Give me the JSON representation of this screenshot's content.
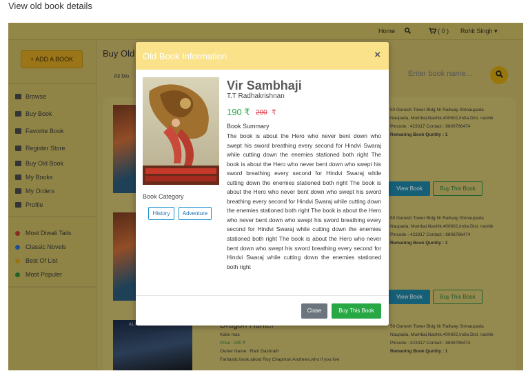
{
  "caption": "View old book details",
  "topbar": {
    "home": "Home",
    "cart_count": "( 0 )",
    "user": "Rohit Singh ▾"
  },
  "sidebar": {
    "add_button": "+ ADD A BOOK",
    "nav": [
      "Browse",
      "Buy Book",
      "Favorite Book",
      "Register Store",
      "Buy Old Book",
      "My Books",
      "My Orders",
      "Profile"
    ],
    "lists": [
      {
        "label": "Most Diwali Tails",
        "color": "#c0392b"
      },
      {
        "label": "Classic Novels",
        "color": "#2c6fd1"
      },
      {
        "label": "Best Of List",
        "color": "#d4a017"
      },
      {
        "label": "Most Populer",
        "color": "#2e8b3a"
      }
    ]
  },
  "main": {
    "title": "Buy Old",
    "tabs": "All  Mo",
    "search_placeholder": "Enter book name...",
    "cards": [
      {
        "address": "50 Ganesh Tower Bldg Nr Railway Stnnaupada",
        "address2": "Naupada, Mumbai,Nashik,400602,India Dist. nashik",
        "pincode": "Pincode : 423317 Contact : 8806786474",
        "quantity": "Remaning Book Quntity : 1",
        "view_label": "View Book",
        "buy_label": "Buy This Book"
      },
      {
        "address": "50 Ganesh Tower Bldg Nr Railway Stnnaupada",
        "address2": "Naupada, Mumbai,Nashik,400602,India Dist. nashik",
        "pincode": "Pincode : 423317 Contact : 8806786474",
        "quantity": "Remaning Book Quntity : 1",
        "view_label": "View Book",
        "buy_label": "Buy This Book"
      },
      {
        "title": "Dragon Hunter",
        "author": "Katie mac",
        "price": "Price : 240  ₹",
        "owner": "Owner Name : Ram Dashrath",
        "summary": "Fantastic book about Roy Chapman Andrews,who if you live",
        "cover_text": "ALISHA KLAPHEKE",
        "address": "50 Ganesh Tower Bldg Nr Railway Stnnaupada",
        "address2": "Naupada, Mumbai,Nashik,400602,India Dist. nashik",
        "pincode": "Pincode : 423317 Contact : 8806786474",
        "quantity": "Remaning Book Quntity : 1"
      }
    ]
  },
  "modal": {
    "header": "Old Book Information",
    "close_icon": "×",
    "book_title": "Vir Sambhaji",
    "author": "T.T Radhakrishnan",
    "price": "190 ₹",
    "old_price": "200",
    "old_price_symbol": "₹",
    "summary_label": "Book Summary",
    "summary": "The book is about the Hero who never bent down who swept his sword breathing every second for Hindvi Swaraj while cutting down the enemies stationed both right The book is about the Hero who never bent down who swept his sword breathing every second for Hindvi Swaraj while cutting down the enemies stationed both right The book is about the Hero who never bent down who swept his sword breathing every second for Hindvi Swaraj while cutting down the enemies stationed both right The book is about the Hero who never bent down who swept his sword breathing every second for Hindvi Swaraj while cutting down the enemies stationed both right The book is about the Hero who never bent down who swept his sword breathing every second for Hindvi Swaraj while cutting down the enemies stationed both right",
    "category_label": "Book Category",
    "categories": [
      "History",
      "Adventure"
    ],
    "close_button": "Close",
    "buy_button": "Buy This Book"
  }
}
